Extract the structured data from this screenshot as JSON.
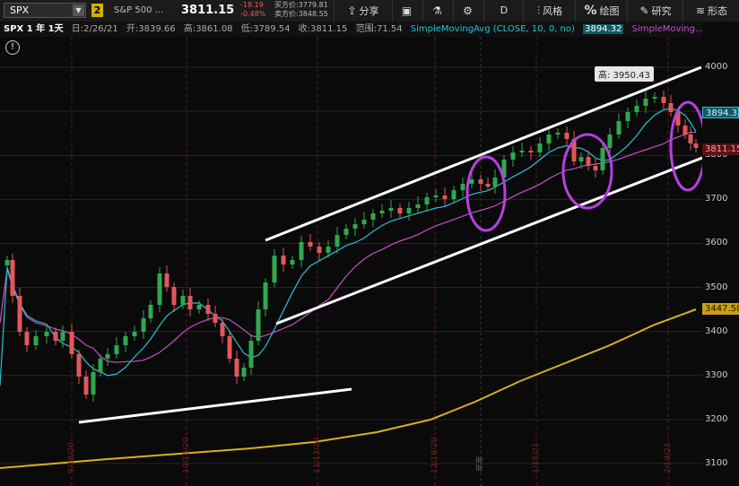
{
  "toolbar": {
    "symbol": "SPX",
    "link_badge": "2",
    "description": "S&P 500 ...",
    "last_price": "3811.15",
    "net_change": "-18.19",
    "pct_change": "-0.48%",
    "bid": "买方价:3779.81",
    "ask": "卖方价:3848.55",
    "share_label": "分享",
    "period_label": "D",
    "style_label": "风格",
    "drawings_label": "绘图",
    "studies_label": "研究",
    "patterns_label": "形态"
  },
  "infobar": {
    "title": "SPX 1 年 1天",
    "date": "日:2/26/21",
    "open": "开:3839.66",
    "high": "高:3861.08",
    "low": "低:3789.54",
    "close": "收:3811.15",
    "range": "范围:71.54",
    "study1": "SimpleMovingAvg (CLOSE, 10, 0, no)",
    "study1_value": "3894.32",
    "study2": "SimpleMoving..."
  },
  "price_axis": {
    "labels": [
      "4000",
      "3900",
      "3800",
      "3700",
      "3600",
      "3500",
      "3400",
      "3300",
      "3200",
      "3100"
    ],
    "tag_sma10": "3894.32",
    "tag_last": "3811.15",
    "tag_sma200": "3447.58"
  },
  "high_tag": "高: 3950.43",
  "date_labels": [
    "9/18/20",
    "10/16/20",
    "11/13/20",
    "12/18/20",
    "1/15/21",
    "2/19/21"
  ],
  "year_marker": "年年",
  "colors": {
    "up": "#2fa84f",
    "down": "#e0585a",
    "sma10": "#2bc0d8",
    "sma20": "#c84fc8",
    "sma200": "#d8b020",
    "circle": "#b640e0",
    "trendline": "#ffffff"
  },
  "chart_data": {
    "type": "candlestick",
    "title": "SPX 1 年 1天",
    "ylim": [
      3100,
      4000
    ],
    "last_candle": {
      "date": "2/26/21",
      "open": 3839.66,
      "high": 3861.08,
      "low": 3789.54,
      "close": 3811.15
    },
    "series": [
      {
        "name": "SimpleMovingAvg (CLOSE, 10, 0, no)",
        "last_value": 3894.32
      },
      {
        "name": "SimpleMoving...",
        "last_value": 3447.58
      }
    ],
    "annotations": {
      "period_high": 3950.43
    }
  }
}
